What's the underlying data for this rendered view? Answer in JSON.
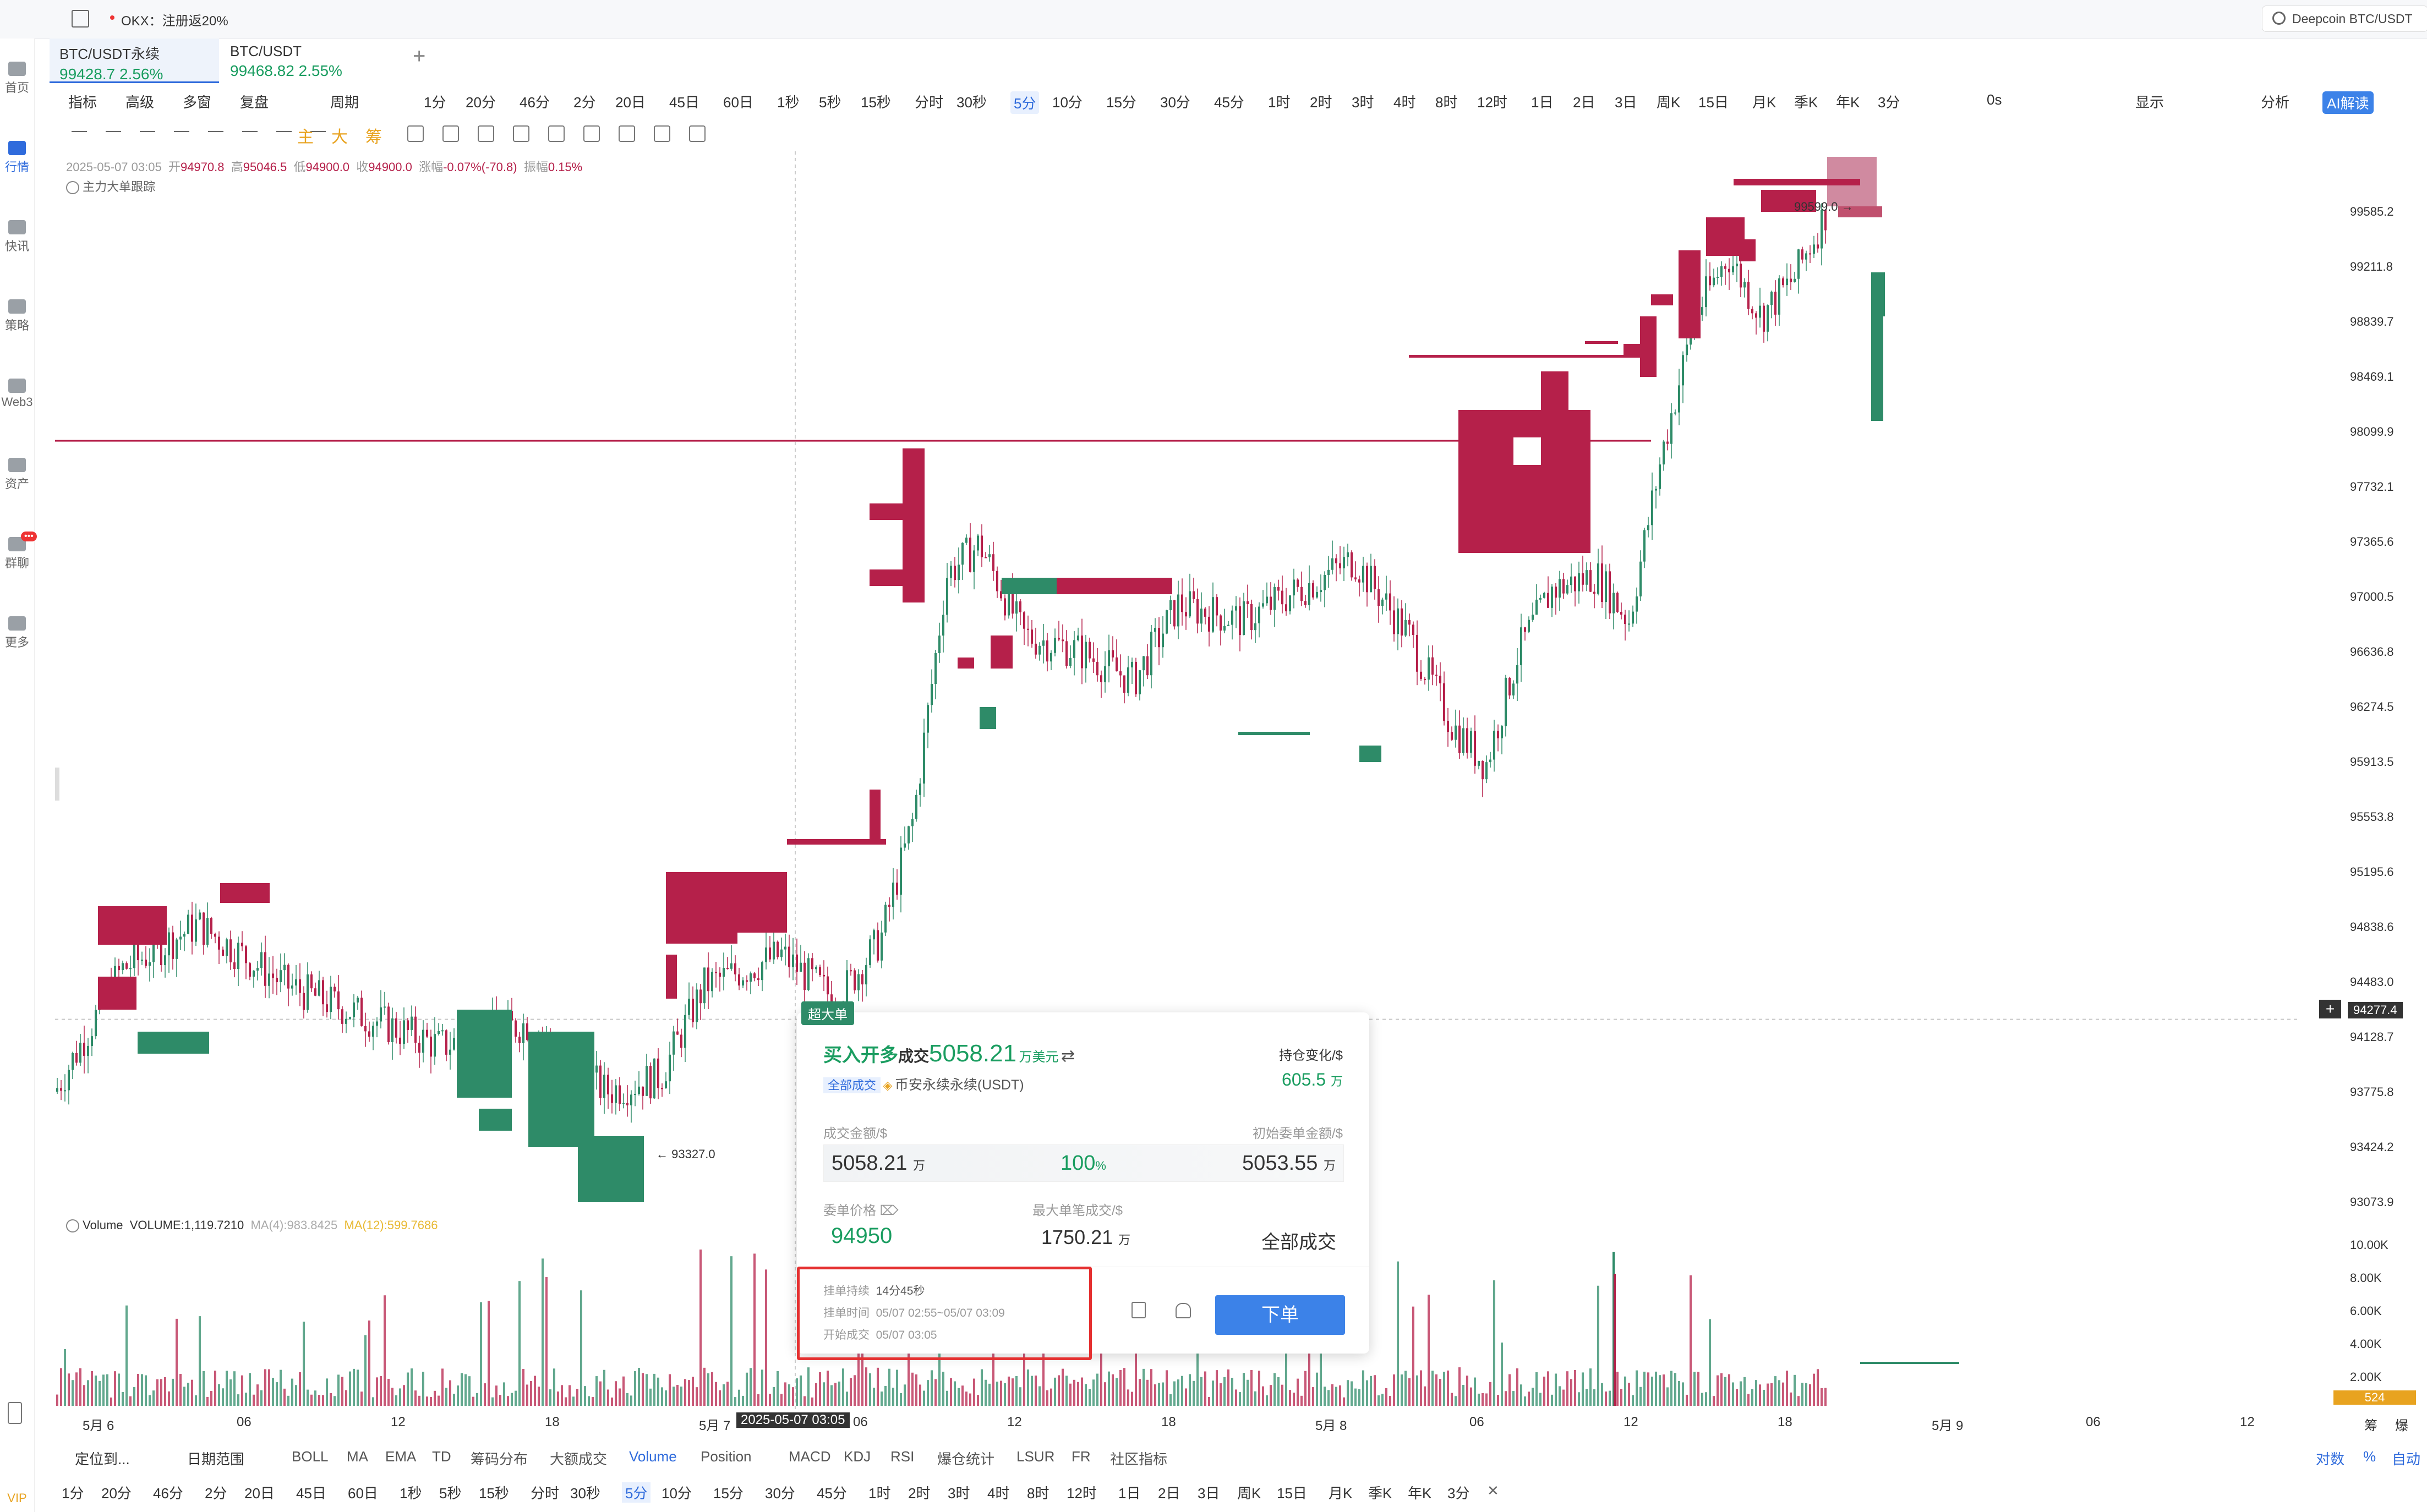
{
  "topbar": {
    "notice": "OKX：注册返20%",
    "search": "Deepcoin BTC/USDT"
  },
  "sidebar": [
    {
      "label": "首页",
      "icon": "home-icon"
    },
    {
      "label": "行情",
      "icon": "market-icon",
      "active": true
    },
    {
      "label": "快讯",
      "icon": "news-icon"
    },
    {
      "label": "策略",
      "icon": "strategy-icon"
    },
    {
      "label": "Web3",
      "icon": "web3-icon"
    },
    {
      "label": "资产",
      "icon": "wallet-icon"
    },
    {
      "label": "群聊",
      "icon": "chat-icon",
      "badge": "•••"
    },
    {
      "label": "更多",
      "icon": "more-icon"
    }
  ],
  "sidebar_vip": "VIP",
  "tabs": [
    {
      "name": "BTC/USDT永续",
      "price": "99428.7  2.56%"
    },
    {
      "name": "BTC/USDT",
      "price": "99468.82  2.55%"
    }
  ],
  "tab_add": "+",
  "toolbar1": {
    "left": [
      "指标",
      "高级",
      "多窗",
      "复盘",
      "",
      "周期"
    ],
    "periods": [
      "1分",
      "20分",
      "46分",
      "2分",
      "20日",
      "45日",
      "60日",
      "1秒",
      "5秒",
      "15秒",
      "分时",
      "30秒",
      "5分",
      "10分",
      "15分",
      "30分",
      "45分",
      "1时",
      "2时",
      "3时",
      "4时",
      "8时",
      "12时",
      "1日",
      "2日",
      "3日",
      "周K",
      "15日",
      "月K",
      "季K",
      "年K",
      "3分"
    ],
    "active_period": "5分",
    "right": [
      "0s",
      "显示",
      "分析",
      "AI解读"
    ]
  },
  "toolbar2": {
    "labels": [
      "主",
      "大",
      "筹"
    ]
  },
  "ohlc": {
    "time": "2025-05-07 03:05",
    "open_label": "开",
    "open": "94970.8",
    "high_label": "高",
    "high": "95046.5",
    "low_label": "低",
    "low": "94900.0",
    "close_label": "收",
    "close": "94900.0",
    "chg_label": "涨幅",
    "chg": "-0.07%(-70.8)",
    "amp_label": "振幅",
    "amp": "0.15%"
  },
  "tracker": "主力大单跟踪",
  "volume_legend": {
    "name": "Volume",
    "volume": "VOLUME:1,119.7210",
    "ma4": "MA(4):983.8425",
    "ma12": "MA(12):599.7686"
  },
  "price_axis": [
    "99585.2",
    "99211.8",
    "98839.7",
    "98469.1",
    "98099.9",
    "97732.1",
    "97365.6",
    "97000.5",
    "96636.8",
    "96274.5",
    "95913.5",
    "95553.8",
    "95195.6",
    "94838.6",
    "94483.0",
    "94128.7",
    "93775.8",
    "93424.2",
    "93073.9"
  ],
  "volume_axis": [
    "10.00K",
    "8.00K",
    "6.00K",
    "4.00K",
    "2.00K"
  ],
  "volume_current": "524",
  "cursor_price": "94277.4",
  "high_marker": "99599.0",
  "low_marker": "93327.0",
  "time_axis": [
    "5月 6",
    "06",
    "12",
    "18",
    "5月 7",
    "06",
    "12",
    "18",
    "5月 8",
    "06",
    "12",
    "18",
    "5月 9",
    "06",
    "12"
  ],
  "cursor_time": "2025-05-07 03:05",
  "axis_right_labels": [
    "筹",
    "爆"
  ],
  "popup": {
    "tag": "超大单",
    "title_prefix": "买入开多",
    "title_mid": "成交",
    "title_amount": "5058.21",
    "title_unit": "万美元",
    "badge": "全部成交",
    "exchange": "币安永续永续(USDT)",
    "oi_label": "持仓变化/$",
    "oi_value": "605.5",
    "oi_unit": "万",
    "deal_label": "成交金额/$",
    "init_label": "初始委单金额/$",
    "deal_value": "5058.21",
    "deal_unit": "万",
    "pct": "100",
    "pct_unit": "%",
    "init_value": "5053.55",
    "init_unit": "万",
    "price_label": "委单价格",
    "max_label": "最大单笔成交/$",
    "price_value": "94950",
    "max_value": "1750.21",
    "max_unit": "万",
    "status": "全部成交",
    "dur_label": "挂单持续",
    "dur_value": "14分45秒",
    "time_label": "挂单时间",
    "time_value": "05/07 02:55~05/07 03:09",
    "start_label": "开始成交",
    "start_value": "05/07 03:05",
    "order_btn": "下单"
  },
  "bottom1": {
    "locate": "定位到...",
    "range": "日期范围",
    "indicators": [
      "BOLL",
      "MA",
      "EMA",
      "TD",
      "筹码分布",
      "大额成交",
      "Volume",
      "Position",
      "MACD",
      "KDJ",
      "RSI",
      "爆仓统计",
      "LSUR",
      "FR",
      "社区指标"
    ],
    "active": "Volume",
    "right": [
      "对数",
      "%",
      "自动"
    ]
  },
  "bottom2": {
    "periods": [
      "1分",
      "20分",
      "46分",
      "2分",
      "20日",
      "45日",
      "60日",
      "1秒",
      "5秒",
      "15秒",
      "分时",
      "30秒",
      "5分",
      "10分",
      "15分",
      "30分",
      "45分",
      "1时",
      "2时",
      "3时",
      "4时",
      "8时",
      "12时",
      "1日",
      "2日",
      "3日",
      "周K",
      "15日",
      "月K",
      "季K",
      "年K",
      "3分"
    ],
    "active": "5分",
    "close": "✕"
  },
  "colors": {
    "up": "#2e8b68",
    "down": "#b5204a",
    "accent": "#2f6bdc"
  }
}
